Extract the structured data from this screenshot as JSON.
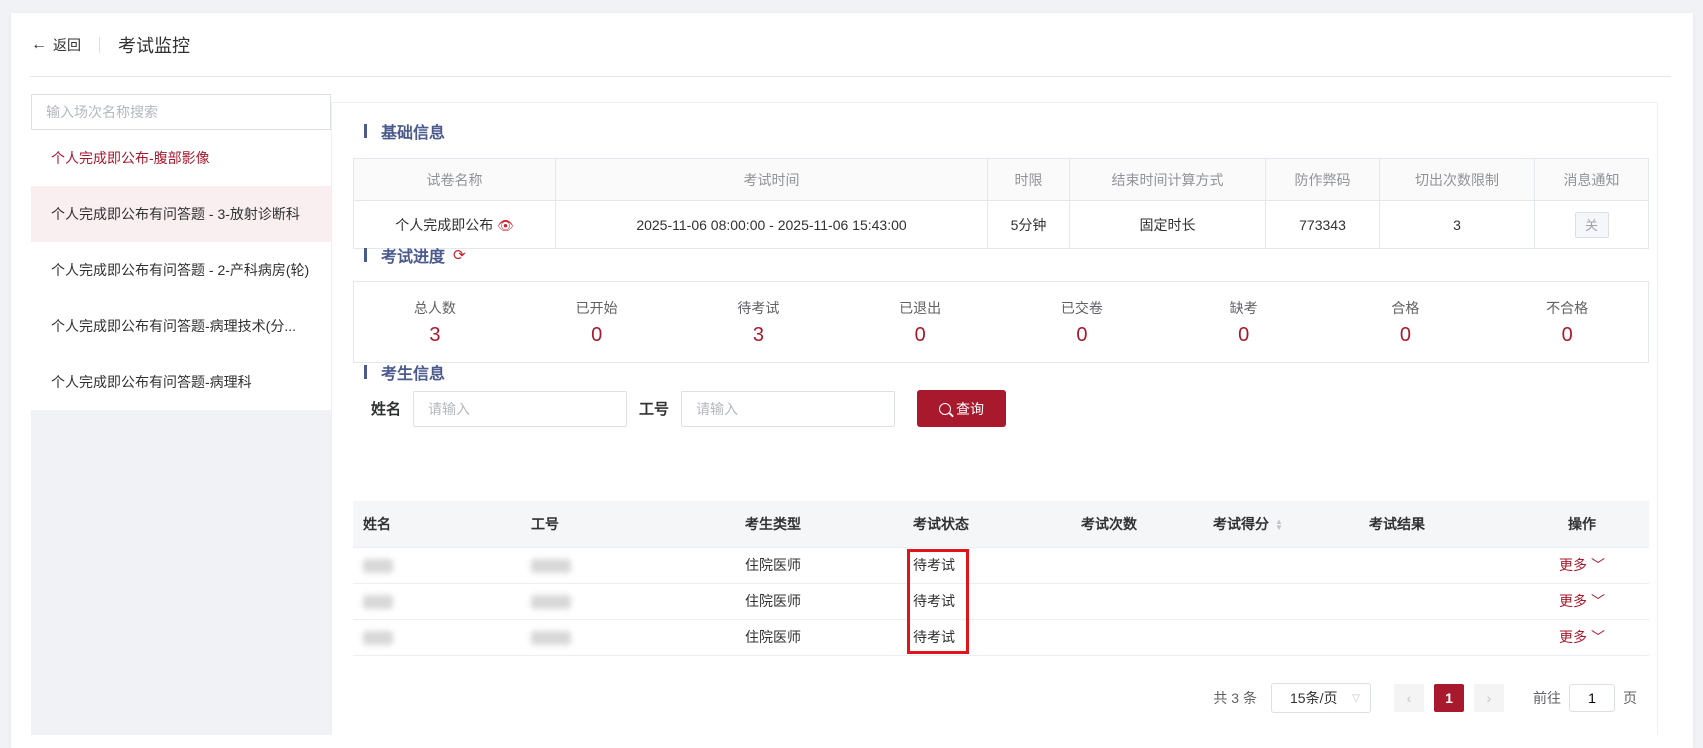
{
  "header": {
    "back_label": "返回",
    "title": "考试监控"
  },
  "sidebar": {
    "search_placeholder": "输入场次名称搜索",
    "items": [
      {
        "label": "个人完成即公布-腹部影像",
        "active": true
      },
      {
        "label": "个人完成即公布有问答题 - 3-放射诊断科"
      },
      {
        "label": "个人完成即公布有问答题 - 2-产科病房(轮)"
      },
      {
        "label": "个人完成即公布有问答题-病理技术(分..."
      },
      {
        "label": "个人完成即公布有问答题-病理科"
      }
    ]
  },
  "basic_info": {
    "title": "基础信息",
    "headers": [
      "试卷名称",
      "考试时间",
      "时限",
      "结束时间计算方式",
      "防作弊码",
      "切出次数限制",
      "消息通知"
    ],
    "paper_name": "个人完成即公布",
    "exam_time": "2025-11-06 08:00:00 - 2025-11-06 15:43:00",
    "time_limit": "5分钟",
    "end_calc": "固定时长",
    "anti_cheat_code": "773343",
    "switch_limit": "3",
    "notify_btn": "关"
  },
  "progress": {
    "title": "考试进度",
    "stats": [
      {
        "label": "总人数",
        "value": "3"
      },
      {
        "label": "已开始",
        "value": "0"
      },
      {
        "label": "待考试",
        "value": "3"
      },
      {
        "label": "已退出",
        "value": "0"
      },
      {
        "label": "已交卷",
        "value": "0"
      },
      {
        "label": "缺考",
        "value": "0"
      },
      {
        "label": "合格",
        "value": "0"
      },
      {
        "label": "不合格",
        "value": "0"
      }
    ]
  },
  "examinee": {
    "title": "考生信息",
    "name_label": "姓名",
    "name_placeholder": "请输入",
    "id_label": "工号",
    "id_placeholder": "请输入",
    "query_label": "查询",
    "columns": [
      "姓名",
      "工号",
      "考生类型",
      "考试状态",
      "考试次数",
      "考试得分",
      "考试结果",
      "操作"
    ],
    "rows": [
      {
        "type": "住院医师",
        "status": "待考试",
        "more": "更多"
      },
      {
        "type": "住院医师",
        "status": "待考试",
        "more": "更多"
      },
      {
        "type": "住院医师",
        "status": "待考试",
        "more": "更多"
      }
    ]
  },
  "pagination": {
    "total": "共 3 条",
    "page_size": "15条/页",
    "current_page": "1",
    "goto_prefix": "前往",
    "goto_value": "1",
    "goto_suffix": "页"
  },
  "colors": {
    "accent": "#a8192e",
    "section_title": "#4a5a8c",
    "highlight_box": "#e0151c"
  }
}
